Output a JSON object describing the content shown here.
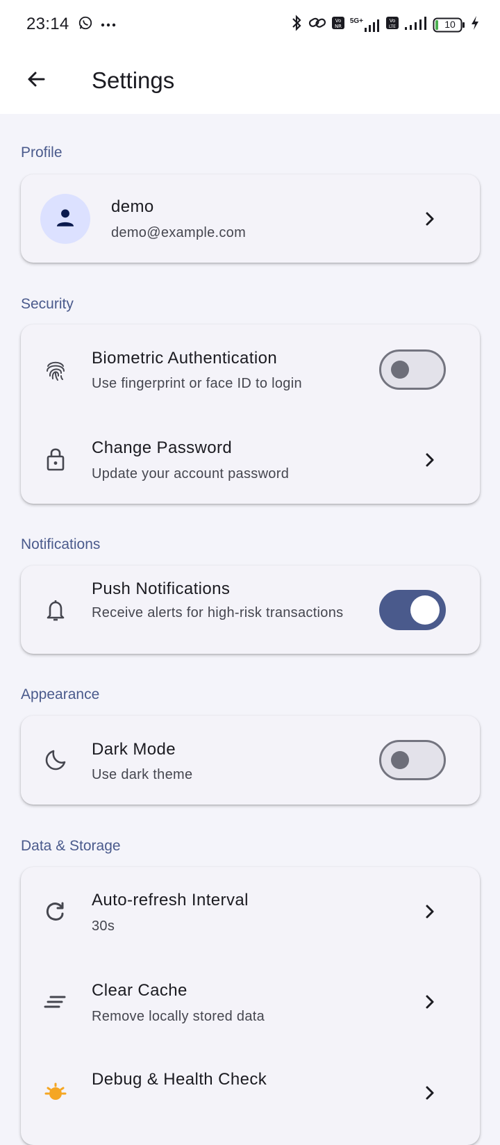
{
  "status_bar": {
    "time": "23:14",
    "network_label": "5G+",
    "battery_level": "10"
  },
  "app_bar": {
    "title": "Settings"
  },
  "sections": {
    "profile": {
      "header": "Profile",
      "name": "demo",
      "email": "demo@example.com"
    },
    "security": {
      "header": "Security",
      "biometric": {
        "title": "Biometric Authentication",
        "subtitle": "Use fingerprint or face ID to login",
        "enabled": false
      },
      "password": {
        "title": "Change Password",
        "subtitle": "Update your account password"
      }
    },
    "notifications": {
      "header": "Notifications",
      "push": {
        "title": "Push Notifications",
        "subtitle": "Receive alerts for high-risk transactions",
        "enabled": true
      }
    },
    "appearance": {
      "header": "Appearance",
      "dark_mode": {
        "title": "Dark Mode",
        "subtitle": "Use dark theme",
        "enabled": false
      }
    },
    "data_storage": {
      "header": "Data & Storage",
      "auto_refresh": {
        "title": "Auto-refresh Interval",
        "subtitle": "30s"
      },
      "clear_cache": {
        "title": "Clear Cache",
        "subtitle": "Remove locally stored data"
      },
      "debug": {
        "title": "Debug & Health Check"
      }
    }
  },
  "colors": {
    "accent": "#4A5A8C",
    "background": "#F4F4FA",
    "card": "#F4F3F9",
    "avatar_bg": "#DCE1FF",
    "debug_icon": "#F5A623"
  },
  "icons": {
    "back": "arrow-left-icon",
    "profile": "person-icon",
    "biometric": "fingerprint-icon",
    "password": "lock-icon",
    "push": "bell-icon",
    "dark_mode": "moon-icon",
    "auto_refresh": "refresh-icon",
    "clear_cache": "clear-all-icon",
    "debug": "bug-icon",
    "chevron": "chevron-right-icon"
  }
}
